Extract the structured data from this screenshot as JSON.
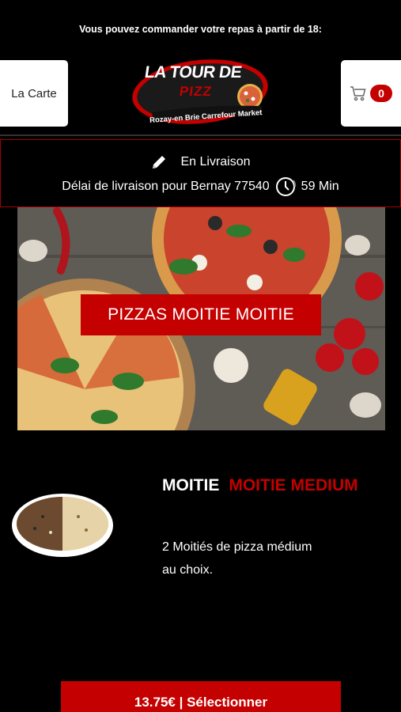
{
  "banner": {
    "text": "Vous pouvez commander votre repas à partir de 18:"
  },
  "header": {
    "carte_label": "La Carte",
    "cart_count": "0",
    "logo": {
      "line1": "LA TOUR DE",
      "line2": "PIZZ",
      "subtitle": "Rozay-en Brie Carrefour Market"
    }
  },
  "delivery": {
    "mode": "En Livraison",
    "delay_text": "Délai de livraison pour Bernay 77540",
    "delay_time": "59 Min"
  },
  "category": {
    "title": "PIZZAS MOITIE MOITIE"
  },
  "product": {
    "name_part1": "MOITIE",
    "name_part2": "MOITIE MEDIUM",
    "description": "2 Moitiés de pizza médium au choix.",
    "button_label": "13.75€ | Sélectionner"
  },
  "colors": {
    "accent": "#c40000",
    "background": "#000000"
  },
  "icons": {
    "edit": "pencil-icon",
    "clock": "clock-icon",
    "cart": "cart-icon"
  }
}
